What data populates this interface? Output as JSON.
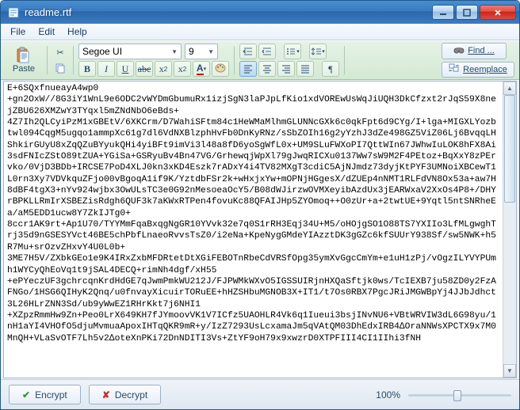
{
  "window": {
    "title": "readme.rtf"
  },
  "menu": {
    "file": "File",
    "edit": "Edit",
    "help": "Help"
  },
  "toolbar": {
    "paste": "Paste",
    "font_name": "Segoe UI",
    "font_size": "9",
    "find": "Find ...",
    "replace": "Reemplace"
  },
  "content": "E+6SQxfnueayA4wp0\n+gn2OxW//8G3iY1WnL9e6ODC2vWYDmGbumuRx1izjSgN3laPJpLfKio1xdVOREwUsWqJiUQH3DkCfzxt2rJqS59X8nejZBU626XMZwY3TYqxl5mZNdNbO6eBds+\n4Z7Ih2QLCyiPzM1xGBEtV/6XKCrm/D7WahiSFtm84c1HeWMaMlhmGLUNNcGXk6c0qkFpt6d9CYg/I+lga+MIGXLYozbtwl094CqgM5ugqo1ammpXc61g7dl6VdNXBlzphHvFb0DnKyRNz/sSbZOIh16g2yYzhJ3dZe498GZ5ViZ06Lj6BvqqLHShkirGUyU8xZqQZuBYyukQHi4yiBFt9imVi3l48a8fD6yoSgWfL0x+UM9SLuFWXoPI7QttWIn67JWhwIuLOK8hFX8Ai3sdFNIcZStO89tZUA+YGiSa+GSRyuBv4Bn47VG/GrhewqjWpXl79gJwqRICXu0137Ww7sW9M2F4PEtoz+BqXxY8zPErvko/0VjD3BDb+IRCSE7PoD4XLJ0kn3xKD4Eszk7rADxY4i4TV82MXgT3cdiC5AjNJmdz73dyjKtPYF3UMNoiXBCewT1L0rn3Xy7VDVkquZFjo00vBgoqA1if9K/YztdbFSr2k+wHxjxYw+mOPNjHGgesX/dZUEp4nNMT1RLFdVN8Ox53a+aw7H8dBF4tgX3+nYv924wjbx3OwULsTC3e0G92nMesoeaOcY5/B08dWJirzwOVMXeyibAzdUx3jEARWxaV2XxOs4P8+/DHYrBPKLLRmIrXSBEZisRdgh6QUF3k7aKWxRTPen4fovuKc88QFAIJHp5ZYOmoq++O0zUr+a+2twtUE+9Yqtl5ntSNRheEa/aM5EDD1ucw8Y7ZkIJTg0+\n8ccr1AK9rt+Ap1U70/TYYMmFqaBxqgNgGR10YVvk32e7q0S1rRH3Eqj34U+M5/oHOjgSO1O88TS7YXIIo3LfMLgwghTrj35d9nGSESYVct46BE5chPbfLnaeoRvvsTsZ0/i2eNa+KpeNygGMdeYIAzztDK3gGZc6kfSUUrY938Sf/sw5NWK+h5R7Mu+srOzvZHxvY4U0L0b+\n3ME7H5V/ZXbkGEo1e9K4IRxZxbMFDRtetDtXGiFEBOTnRbeCdVRSfOpg35ymXvGgcCmYm+e1uH1zPj/vOgzILYVYPUmh1WYCyQhEoVq1t9jSAL4DECQ+rimNh4dgf/xH55\n+ePYeczUF3gchrcqnKrdHdGE7qJwmPmkWU212J/FJPWMkWXvO5IGSSUIRjnHXQaSftjk0ws/TcIEXB7ju58ZD0y2FzAFNGo/1HSG6QIHyK2Qnq/u0fnvayXicuirTORuEE+hHZSHbuMGNOB3X+IT1/t7Os0RBX7PgcJRiJMGWBpYj4JJbJdhct3L26HLrZNN3Sd/ub9yWwEZ1RHrKkt7j6NHI1\n+XZpzRmmHw9Zn+Peo0LrX649KH7fJYmoovVK1V7ICfz5UAOHLR4Vk6q1Iueui3bsjINvNU6+VBtWRVIW3dL6G98yu/1nH1aYI4VHOfO5djuMvmuaApoxIHTqQKR9mR+y/IzZ7293UsLcxamaJm5qVAtQM03DhEdxIRB4∆OraNNWsXPCTX9x7M0MnQH+VLaSvOTF7Lh5v2∆oteXnPKi72DnNDITI3Vs+ZtYF9oH79x9xwzrD0XTPFIII4CI1IIhi3fNH",
  "footer": {
    "encrypt": "Encrypt",
    "decrypt": "Decrypt",
    "zoom": "100%"
  }
}
